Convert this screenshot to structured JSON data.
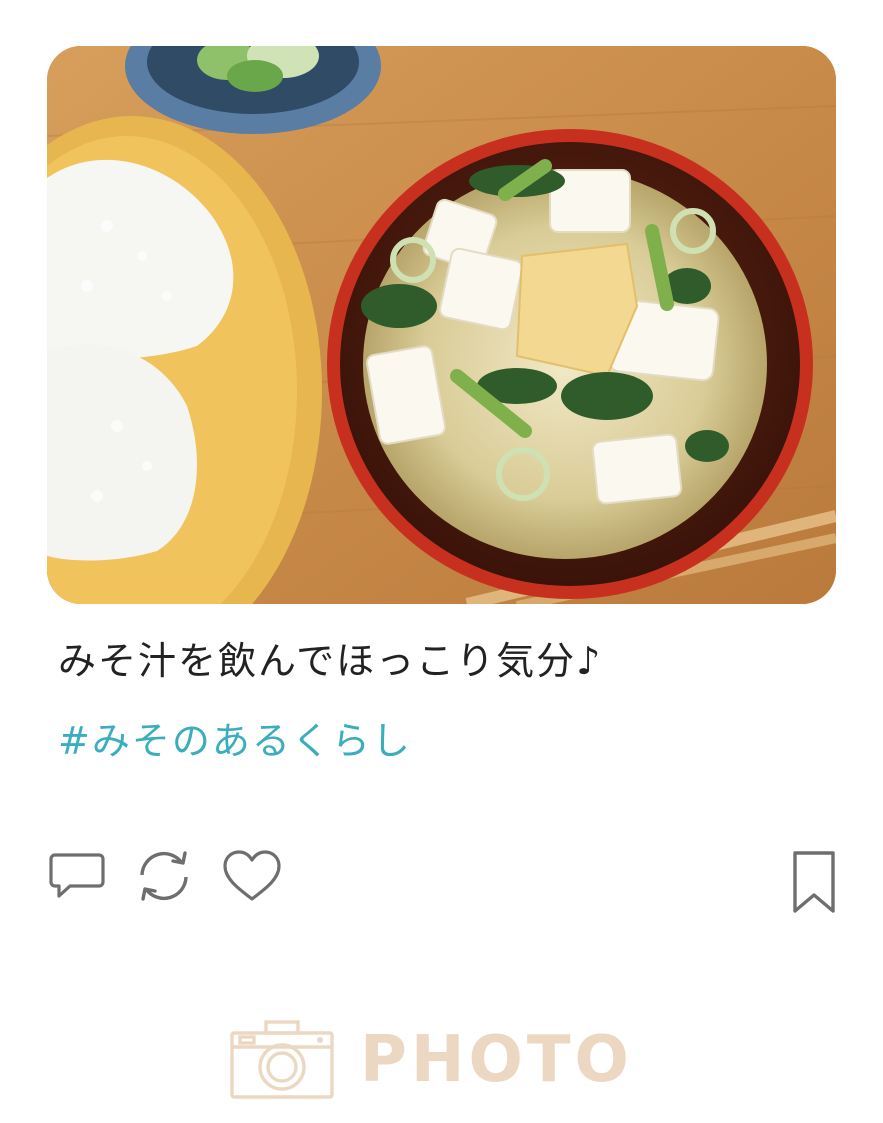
{
  "post": {
    "caption": "みそ汁を飲んでほっこり気分♪",
    "hashtag": "#みそのあるくらし",
    "image_icon": "photo-of-miso-soup-and-onigiri"
  },
  "actions": {
    "comment_icon": "speech-bubble-icon",
    "repost_icon": "repost-arrows-icon",
    "like_icon": "heart-icon",
    "bookmark_icon": "bookmark-icon",
    "icon_color": "#6e6e6e"
  },
  "footer": {
    "logo_text": "PHOTO",
    "logo_icon": "camera-icon",
    "logo_color": "#ecd8c2"
  },
  "colors": {
    "caption": "#222222",
    "hashtag": "#3aaebc",
    "background": "#ffffff"
  }
}
